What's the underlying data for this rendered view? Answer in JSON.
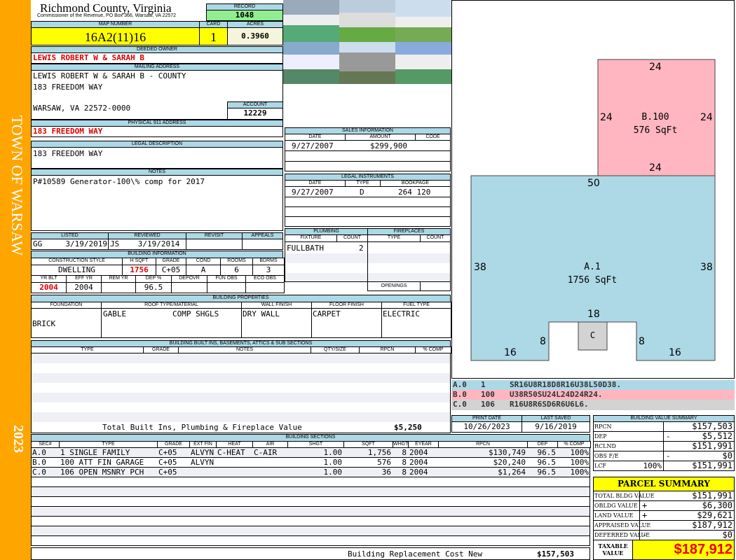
{
  "side": {
    "town": "TOWN OF WARSAW",
    "year": "2023",
    "color": "#FFA500"
  },
  "header": {
    "county": "Richmond County, Virginia",
    "subtitle": "Commissioner of the Revenue, PO Box 366, Warsaw, VA 22572",
    "record_label": "RECORD",
    "record": "1048"
  },
  "parcel": {
    "map_label": "MAP NUMBER",
    "map": "16A2(11)16",
    "card_label": "CARD",
    "card": "1",
    "acres_label": "ACRES",
    "acres": "0.3960"
  },
  "owner": {
    "label": "DEEDED OWNER",
    "value": "LEWIS ROBERT W & SARAH B"
  },
  "mailing": {
    "label": "MAILING ADDRESS",
    "line1": "LEWIS ROBERT W & SARAH B - COUNTY",
    "line2": "183 FREEDOM WAY",
    "line3": "WARSAW, VA 22572-0000",
    "account_label": "ACCOUNT",
    "account": "12229"
  },
  "physical": {
    "label": "PHYSICAL 911 ADDRESS",
    "value": "183 FREEDOM WAY"
  },
  "legal": {
    "label": "LEGAL DESCRIPTION",
    "value": "183 FREEDOM WAY"
  },
  "notes": {
    "label": "NOTES",
    "value": "P#10589 Generator-100\\% comp for 2017"
  },
  "sales": {
    "label": "SALES INFORMATION",
    "cols": [
      "DATE",
      "AMOUNT",
      "CODE"
    ],
    "rows": [
      [
        "9/27/2007",
        "$299,900",
        ""
      ]
    ]
  },
  "instruments": {
    "label": "LEGAL INSTRUMENTS",
    "cols": [
      "DATE",
      "TYPE",
      "BOOKPAGE"
    ],
    "rows": [
      [
        "9/27/2007",
        "D",
        "264 120"
      ]
    ]
  },
  "listing": {
    "cols": [
      "LISTED",
      "REVIEWED",
      "REVISIT",
      "APPEALS"
    ],
    "listed": "GG     3/19/2019",
    "reviewed": "JS    3/19/2014",
    "revisit": "",
    "appeals": ""
  },
  "building_info": {
    "label": "BUILDING INFORMATION",
    "cols1": [
      "CONSTRUCTION STYLE",
      "H SQFT",
      "GRADE",
      "COND",
      "ROOMS",
      "BDRMS"
    ],
    "vals1": [
      "DWELLING",
      "1756",
      "C+05",
      "A",
      "6",
      "3"
    ],
    "cols2": [
      "YR BLT",
      "EFF YR",
      "REM YR",
      "DEP %",
      "DEPOVR",
      "FUN OBS",
      "ECO OBS"
    ],
    "vals2": [
      "2004",
      "2004",
      "",
      "96.5",
      "",
      "",
      ""
    ]
  },
  "plumbing": {
    "label": "PLUMBING",
    "cols": [
      "FIXTURE",
      "COUNT"
    ],
    "fixture": "FULLBATH",
    "count": "2"
  },
  "fireplaces": {
    "label": "FIREPLACES",
    "cols": [
      "TYPE",
      "COUNT"
    ],
    "openings": "OPENINGS"
  },
  "properties": {
    "label": "BUILDING PROPERTIES",
    "cols": [
      "FOUNDATION",
      "ROOF TYPE/MATERIAL",
      "WALL FINISH",
      "FLOOR FINISH",
      "FUEL TYPE"
    ],
    "foundation": "BRICK",
    "roof_type": "GABLE",
    "roof_material": "COMP SHGLS",
    "wall": "DRY WALL",
    "floor": "CARPET",
    "fuel": "ELECTRIC"
  },
  "builtins": {
    "label": "BUILDING BUILT INS, BASEMENTS, ATTICS & SUB SECTIONS",
    "cols": [
      "TYPE",
      "GRADE",
      "NOTES",
      "QTY/SIZE",
      "RPCN",
      "% COMP"
    ],
    "total_label": "Total Built Ins, Plumbing & Fireplace Value",
    "total": "$5,250"
  },
  "dates": {
    "print_label": "PRINT DATE",
    "print": "10/26/2023",
    "saved_label": "LAST SAVED",
    "saved": "9/16/2019"
  },
  "sections": {
    "label": "BUILDING SECTIONS",
    "cols": [
      "SEC#",
      "TYPE",
      "GRADE",
      "EXT FIN",
      "HEAT",
      "AIR",
      "SHGT",
      "SQFT",
      "WHGT",
      "EYEAR",
      "RPCN",
      "DEP",
      "% COMP"
    ],
    "rows": [
      [
        "A.0",
        "1 SINGLE FAMILY",
        "C+05",
        "ALVYN",
        "C-HEAT",
        "C-AIR",
        "1.00",
        "1,756",
        "8",
        "2004",
        "$130,749",
        "96.5",
        "100%"
      ],
      [
        "B.0",
        "100 ATT FIN GARAGE",
        "C+05",
        "ALVYN",
        "",
        "",
        "1.00",
        "576",
        "8",
        "2004",
        "$20,240",
        "96.5",
        "100%"
      ],
      [
        "C.0",
        "106 OPEN MSNRY PCH",
        "C+05",
        "",
        "",
        "",
        "1.00",
        "36",
        "8",
        "2004",
        "$1,264",
        "96.5",
        "100%"
      ]
    ],
    "total_label": "Building Replacement Cost New",
    "total": "$157,503"
  },
  "sketch": {
    "B": {
      "name": "B.100",
      "area": "576 SqFt",
      "top": "24",
      "left": "24",
      "right": "24",
      "bottom": "24",
      "color": "#FFB6C1"
    },
    "A": {
      "name": "A.1",
      "area": "1756 SqFt",
      "top": "50",
      "left": "38",
      "right": "38",
      "bl": "16",
      "br": "16",
      "inl": "8",
      "inr": "8",
      "intop": "18",
      "color": "#ADD8E6"
    },
    "C": {
      "name": "C",
      "color": "#D3D3D3"
    },
    "codes": [
      [
        "A.0",
        "1",
        "SR16U8R18D8R16U38L50D38."
      ],
      [
        "B.0",
        "100",
        "U38R50SU24L24D24R24."
      ],
      [
        "C.0",
        "106",
        "R16U8R6SD6R6U6L6."
      ]
    ]
  },
  "value_summary": {
    "label": "BUILDING VALUE SUMMARY",
    "rows": [
      [
        "RPCN",
        "",
        "",
        "$157,503"
      ],
      [
        "DEP",
        "",
        "-",
        "$5,512"
      ],
      [
        "RCLND",
        "",
        "",
        "$151,991"
      ],
      [
        "OBS F/E",
        "",
        "-",
        "$0"
      ],
      [
        "LCF",
        "100%",
        "",
        "$151,991"
      ]
    ]
  },
  "parcel_summary": {
    "label": "PARCEL SUMMARY",
    "rows": [
      [
        "TOTAL BLDG VALUE",
        "",
        "$151,991"
      ],
      [
        "OBLDG VALUE",
        "+",
        "$6,300"
      ],
      [
        "LAND VALUE",
        "+",
        "$29,621"
      ],
      [
        "APPRAISED VALUE",
        "",
        "$187,912"
      ],
      [
        "DEFERRED VALUE",
        "-",
        "$0"
      ]
    ],
    "taxable_label": "TAXABLE VALUE",
    "taxable": "$187,912"
  }
}
